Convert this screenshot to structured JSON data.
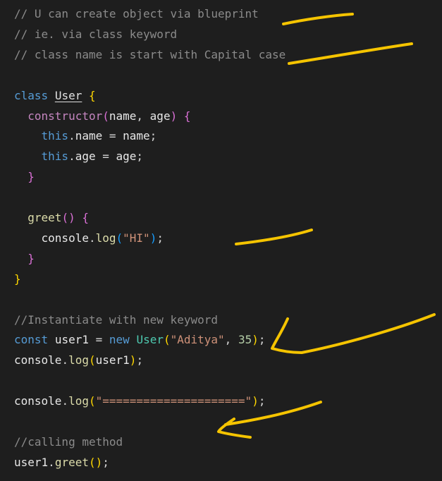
{
  "code": {
    "lines": [
      {
        "tokens": [
          {
            "t": "// U can create object via blueprint",
            "c": "comment"
          }
        ]
      },
      {
        "tokens": [
          {
            "t": "// ie. via class keyword",
            "c": "comment"
          }
        ]
      },
      {
        "tokens": [
          {
            "t": "// class name is start with Capital case",
            "c": "comment"
          }
        ]
      },
      {
        "tokens": []
      },
      {
        "tokens": [
          {
            "t": "class",
            "c": "kw-blue"
          },
          {
            "t": " ",
            "c": "punc"
          },
          {
            "t": "User",
            "c": "cls-plain"
          },
          {
            "t": " ",
            "c": "punc"
          },
          {
            "t": "{",
            "c": "brace-y"
          }
        ]
      },
      {
        "tokens": [
          {
            "t": "  ",
            "c": "punc"
          },
          {
            "t": "constructor",
            "c": "kw-purple"
          },
          {
            "t": "(",
            "c": "brace-p"
          },
          {
            "t": "name",
            "c": "var-w"
          },
          {
            "t": ", ",
            "c": "punc"
          },
          {
            "t": "age",
            "c": "var-w"
          },
          {
            "t": ")",
            "c": "brace-p"
          },
          {
            "t": " ",
            "c": "punc"
          },
          {
            "t": "{",
            "c": "brace-p"
          }
        ]
      },
      {
        "tokens": [
          {
            "t": "    ",
            "c": "punc"
          },
          {
            "t": "this",
            "c": "kw-blue"
          },
          {
            "t": ".",
            "c": "punc"
          },
          {
            "t": "name",
            "c": "var-w"
          },
          {
            "t": " = ",
            "c": "punc"
          },
          {
            "t": "name",
            "c": "var-w"
          },
          {
            "t": ";",
            "c": "punc"
          }
        ]
      },
      {
        "tokens": [
          {
            "t": "    ",
            "c": "punc"
          },
          {
            "t": "this",
            "c": "kw-blue"
          },
          {
            "t": ".",
            "c": "punc"
          },
          {
            "t": "age",
            "c": "var-w"
          },
          {
            "t": " = ",
            "c": "punc"
          },
          {
            "t": "age",
            "c": "var-w"
          },
          {
            "t": ";",
            "c": "punc"
          }
        ]
      },
      {
        "tokens": [
          {
            "t": "  ",
            "c": "punc"
          },
          {
            "t": "}",
            "c": "brace-p"
          }
        ]
      },
      {
        "tokens": []
      },
      {
        "tokens": [
          {
            "t": "  ",
            "c": "punc"
          },
          {
            "t": "greet",
            "c": "fn"
          },
          {
            "t": "()",
            "c": "brace-p"
          },
          {
            "t": " ",
            "c": "punc"
          },
          {
            "t": "{",
            "c": "brace-p"
          }
        ]
      },
      {
        "tokens": [
          {
            "t": "    ",
            "c": "punc"
          },
          {
            "t": "console",
            "c": "var-w"
          },
          {
            "t": ".",
            "c": "punc"
          },
          {
            "t": "log",
            "c": "fn"
          },
          {
            "t": "(",
            "c": "brace-b"
          },
          {
            "t": "\"HI\"",
            "c": "str"
          },
          {
            "t": ")",
            "c": "brace-b"
          },
          {
            "t": ";",
            "c": "punc"
          }
        ]
      },
      {
        "tokens": [
          {
            "t": "  ",
            "c": "punc"
          },
          {
            "t": "}",
            "c": "brace-p"
          }
        ]
      },
      {
        "tokens": [
          {
            "t": "}",
            "c": "brace-y"
          }
        ]
      },
      {
        "tokens": []
      },
      {
        "tokens": [
          {
            "t": "//Instantiate with new keyword",
            "c": "comment"
          }
        ]
      },
      {
        "tokens": [
          {
            "t": "const",
            "c": "kw-blue"
          },
          {
            "t": " ",
            "c": "punc"
          },
          {
            "t": "user1",
            "c": "var-w"
          },
          {
            "t": " = ",
            "c": "punc"
          },
          {
            "t": "new",
            "c": "kw-blue"
          },
          {
            "t": " ",
            "c": "punc"
          },
          {
            "t": "User",
            "c": "cls"
          },
          {
            "t": "(",
            "c": "brace-y"
          },
          {
            "t": "\"Aditya\"",
            "c": "str"
          },
          {
            "t": ", ",
            "c": "punc"
          },
          {
            "t": "35",
            "c": "num"
          },
          {
            "t": ")",
            "c": "brace-y"
          },
          {
            "t": ";",
            "c": "punc"
          }
        ]
      },
      {
        "tokens": [
          {
            "t": "console",
            "c": "var-w"
          },
          {
            "t": ".",
            "c": "punc"
          },
          {
            "t": "log",
            "c": "fn"
          },
          {
            "t": "(",
            "c": "brace-y"
          },
          {
            "t": "user1",
            "c": "var-w"
          },
          {
            "t": ")",
            "c": "brace-y"
          },
          {
            "t": ";",
            "c": "punc"
          }
        ]
      },
      {
        "tokens": []
      },
      {
        "tokens": [
          {
            "t": "console",
            "c": "var-w"
          },
          {
            "t": ".",
            "c": "punc"
          },
          {
            "t": "log",
            "c": "fn"
          },
          {
            "t": "(",
            "c": "brace-y"
          },
          {
            "t": "\"=====================\"",
            "c": "str"
          },
          {
            "t": ")",
            "c": "brace-y"
          },
          {
            "t": ";",
            "c": "punc"
          }
        ]
      },
      {
        "tokens": []
      },
      {
        "tokens": [
          {
            "t": "//calling method",
            "c": "comment"
          }
        ]
      },
      {
        "tokens": [
          {
            "t": "user1",
            "c": "var-w"
          },
          {
            "t": ".",
            "c": "punc"
          },
          {
            "t": "greet",
            "c": "fn"
          },
          {
            "t": "()",
            "c": "brace-y"
          },
          {
            "t": ";",
            "c": "punc"
          }
        ]
      }
    ]
  },
  "annotation_color": "#f5c400"
}
